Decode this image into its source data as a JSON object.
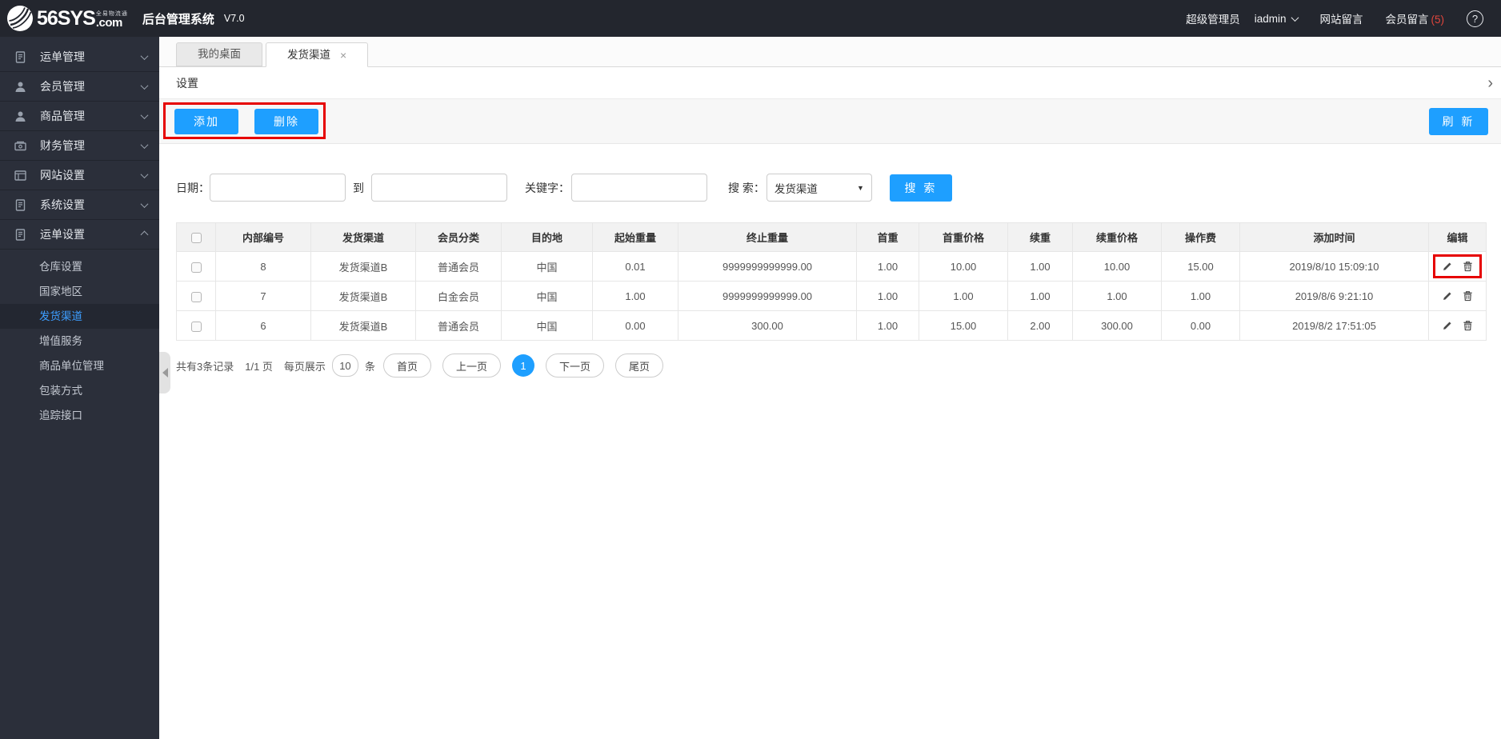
{
  "header": {
    "brand": "56SYS",
    "brand_tagline": "全易物流通",
    "brand_tld": ".com",
    "app_title": "后台管理系统",
    "version": "V7.0",
    "role": "超级管理员",
    "username": "iadmin",
    "site_messages_label": "网站留言",
    "member_messages_label": "会员留言",
    "member_messages_count": "(5)",
    "help_glyph": "?"
  },
  "sidebar": {
    "items": [
      {
        "label": "运单管理",
        "icon": "waybill-icon",
        "expanded": false
      },
      {
        "label": "会员管理",
        "icon": "user-icon",
        "expanded": false
      },
      {
        "label": "商品管理",
        "icon": "user-icon",
        "expanded": false
      },
      {
        "label": "财务管理",
        "icon": "finance-icon",
        "expanded": false
      },
      {
        "label": "网站设置",
        "icon": "browser-icon",
        "expanded": false
      },
      {
        "label": "系统设置",
        "icon": "document-icon",
        "expanded": false
      },
      {
        "label": "运单设置",
        "icon": "document-icon",
        "expanded": true
      }
    ],
    "submenu": [
      {
        "label": "仓库设置",
        "active": false
      },
      {
        "label": "国家地区",
        "active": false
      },
      {
        "label": "发货渠道",
        "active": true
      },
      {
        "label": "增值服务",
        "active": false
      },
      {
        "label": "商品单位管理",
        "active": false
      },
      {
        "label": "包装方式",
        "active": false
      },
      {
        "label": "追踪接口",
        "active": false
      }
    ]
  },
  "tabs": [
    {
      "label": "我的桌面",
      "active": false,
      "closable": false
    },
    {
      "label": "发货渠道",
      "active": true,
      "closable": true,
      "close_glyph": "×"
    }
  ],
  "panel": {
    "title": "设置",
    "collapse_glyph": "›"
  },
  "toolbar": {
    "add_label": "添加",
    "delete_label": "删除",
    "refresh_label": "刷 新"
  },
  "filters": {
    "date_label": "日期：",
    "to_label": "到",
    "keyword_label": "关键字：",
    "search_label": "搜 索：",
    "search_type_selected": "发货渠道",
    "search_caret": "▼",
    "search_button_label": "搜 索"
  },
  "table": {
    "columns": [
      "内部编号",
      "发货渠道",
      "会员分类",
      "目的地",
      "起始重量",
      "终止重量",
      "首重",
      "首重价格",
      "续重",
      "续重价格",
      "操作费",
      "添加时间",
      "编辑"
    ],
    "rows": [
      [
        "8",
        "发货渠道B",
        "普通会员",
        "中国",
        "0.01",
        "9999999999999.00",
        "1.00",
        "10.00",
        "1.00",
        "10.00",
        "15.00",
        "2019/8/10 15:09:10"
      ],
      [
        "7",
        "发货渠道B",
        "白金会员",
        "中国",
        "1.00",
        "9999999999999.00",
        "1.00",
        "1.00",
        "1.00",
        "1.00",
        "1.00",
        "2019/8/6 9:21:10"
      ],
      [
        "6",
        "发货渠道B",
        "普通会员",
        "中国",
        "0.00",
        "300.00",
        "1.00",
        "15.00",
        "2.00",
        "300.00",
        "0.00",
        "2019/8/2 17:51:05"
      ]
    ],
    "highlighted_edit_row_index": 0
  },
  "pagination": {
    "total_text": "共有3条记录",
    "page_text": "1/1 页",
    "per_page_label": "每页展示",
    "per_page_value": "10",
    "per_page_unit": "条",
    "first_label": "首页",
    "prev_label": "上一页",
    "current_page": "1",
    "next_label": "下一页",
    "last_label": "尾页"
  }
}
